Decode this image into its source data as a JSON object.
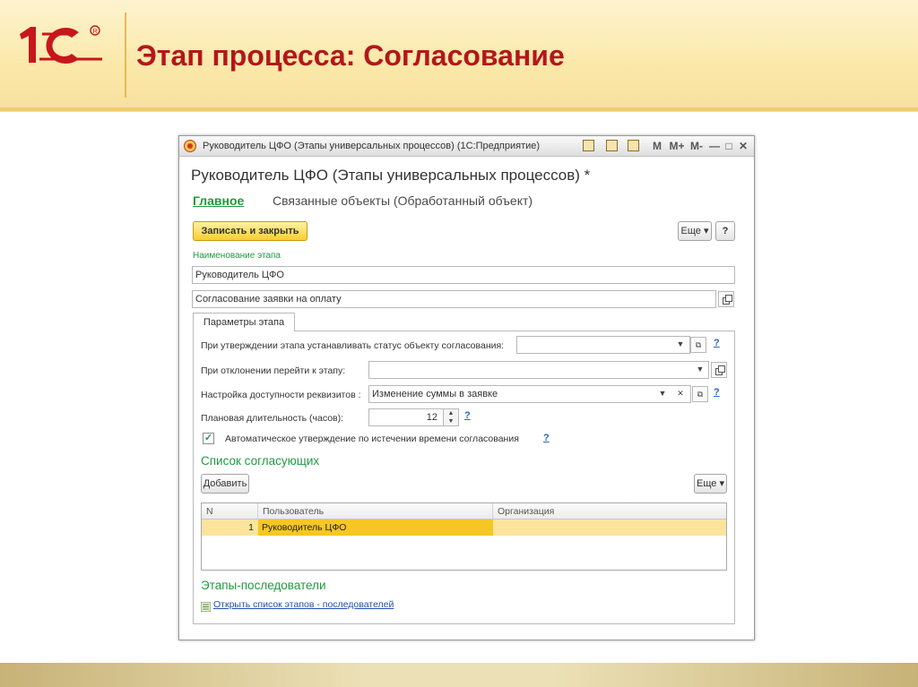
{
  "slide": {
    "title": "Этап процесса: Согласование",
    "logo_text": "1С"
  },
  "window": {
    "caption": "Руководитель ЦФО (Этапы универсальных процессов)  (1С:Предприятие)",
    "titlebar_buttons": [
      "M",
      "M+",
      "M-",
      "—",
      "□",
      "✕"
    ],
    "titlebar_icons": [
      "favorites-icon",
      "calculator-icon",
      "calendar-icon"
    ]
  },
  "form": {
    "title": "Руководитель ЦФО (Этапы универсальных процессов) *",
    "tabs": {
      "main": "Главное",
      "related": "Связанные объекты (Обработанный объект)"
    },
    "save_close": "Записать и закрыть",
    "more": "Еще",
    "help": "?",
    "stage_name_label": "Наименование этапа",
    "stage_name_value": "Руководитель ЦФО",
    "description_value": "Согласование заявки на оплату"
  },
  "params": {
    "tab_label": "Параметры этапа",
    "status_label": "При утверждении этапа устанавливать статус объекту согласования:",
    "status_value": "",
    "reject_label": "При отклонении перейти к этапу:",
    "reject_value": "",
    "access_label": "Настройка доступности реквизитов :",
    "access_value": "Изменение суммы в заявке",
    "duration_label": "Плановая длительность (часов):",
    "duration_value": "12",
    "auto_approve_label": "Автоматическое утверждение по истечении времени согласования",
    "auto_approve_checked": true,
    "help": "?"
  },
  "approvers": {
    "title": "Список согласующих",
    "add_button": "Добавить",
    "more": "Еще",
    "columns": [
      "N",
      "Пользователь",
      "Организация"
    ],
    "rows": [
      {
        "n": "1",
        "user": "Руководитель ЦФО",
        "org": ""
      }
    ]
  },
  "successors": {
    "title": "Этапы-последователи",
    "link": "Открыть список этапов - последователей"
  },
  "colors": {
    "title_red": "#b3171b",
    "accent_green": "#1f9a40",
    "save_yellow": "#f8cf2e",
    "row_highlight": "#fbe49b"
  }
}
